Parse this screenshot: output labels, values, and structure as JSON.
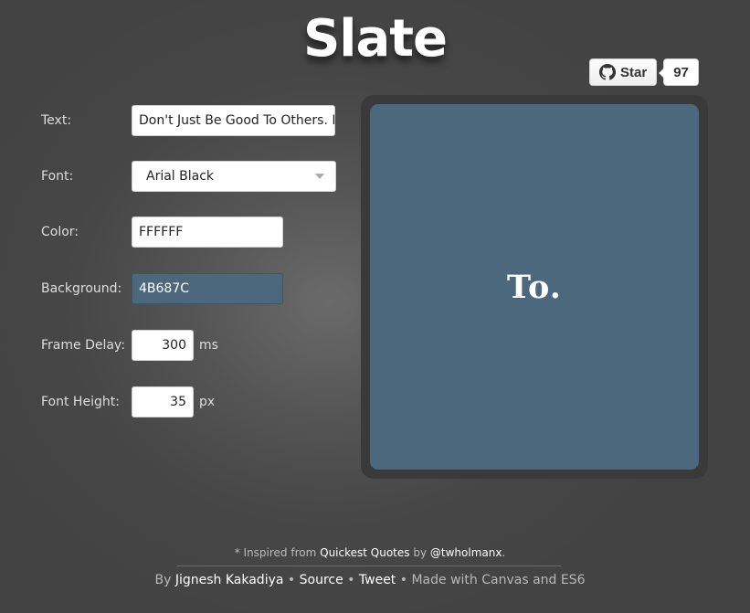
{
  "app": {
    "title": "Slate"
  },
  "github": {
    "star_label": "Star",
    "star_count": "97",
    "icon": "github-icon"
  },
  "form": {
    "text_label": "Text:",
    "text_value": "Don't Just Be Good To Others. Be G",
    "font_label": "Font:",
    "font_value": "Arial Black",
    "color_label": "Color:",
    "color_value": "FFFFFF",
    "background_label": "Background:",
    "background_value": "4B687C",
    "frame_delay_label": "Frame Delay:",
    "frame_delay_value": "300",
    "frame_delay_unit": "ms",
    "font_height_label": "Font Height:",
    "font_height_value": "35",
    "font_height_unit": "px"
  },
  "preview": {
    "word": "To."
  },
  "colors": {
    "preview_bg": "#4B687C",
    "preview_text": "#FFFFFF",
    "page_bg": "#474747"
  },
  "footer": {
    "inspired_prefix": "* Inspired from",
    "inspired_link": "Quickest Quotes",
    "inspired_by": "by",
    "inspired_author": "@twholmanx",
    "inspired_end": ".",
    "by_prefix": "By",
    "author": "Jignesh Kakadiya",
    "sep1": "•",
    "source": "Source",
    "sep2": "•",
    "tweet": "Tweet",
    "sep3": "•",
    "made_with": "Made with Canvas and ES6"
  }
}
